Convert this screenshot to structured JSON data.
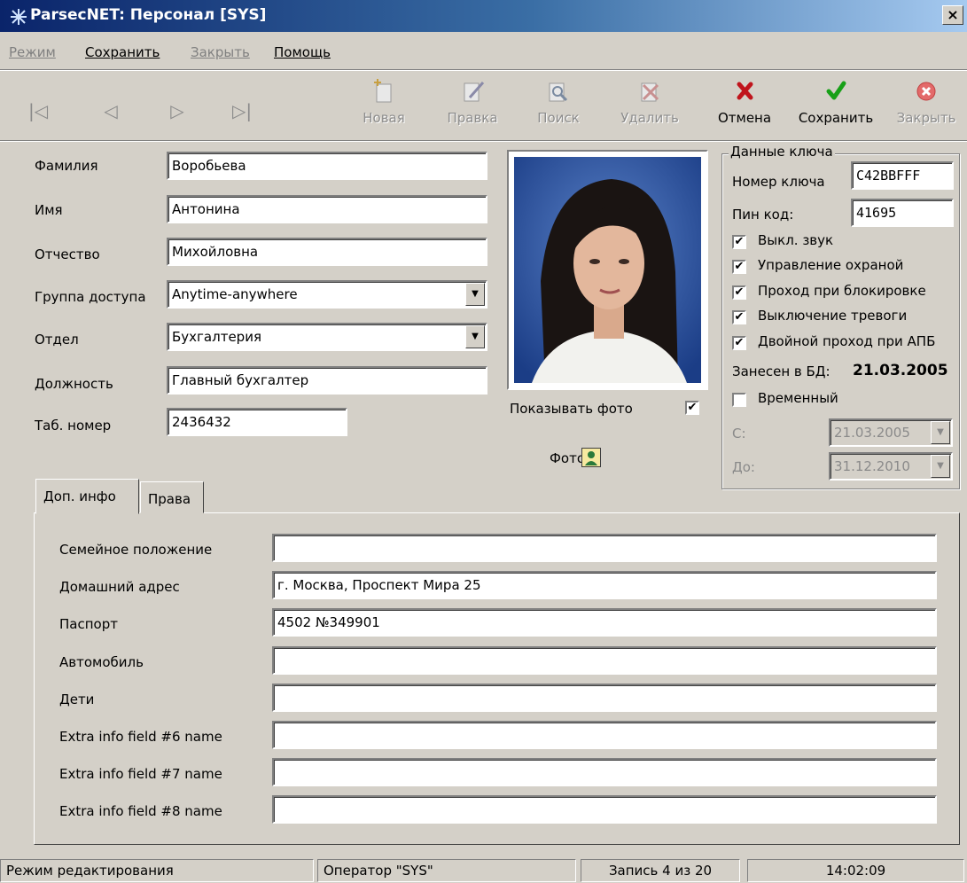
{
  "window": {
    "title": "ParsecNET: Персонал [SYS]",
    "close_glyph": "×"
  },
  "menu": [
    {
      "label": "Режим",
      "enabled": false
    },
    {
      "label": "Сохранить",
      "enabled": true
    },
    {
      "label": "Закрыть",
      "enabled": false
    },
    {
      "label": "Помощь",
      "enabled": true
    }
  ],
  "navigation": {
    "first": "|◁",
    "prev": "◁",
    "next": "▷",
    "last": "▷|"
  },
  "toolbar": {
    "new_label": "Новая",
    "edit_label": "Правка",
    "search_label": "Поиск",
    "delete_label": "Удалить",
    "cancel_label": "Отмена",
    "save_label": "Сохранить",
    "close_label": "Закрыть"
  },
  "person": {
    "lastname_label": "Фамилия",
    "lastname_value": "Воробьева",
    "firstname_label": "Имя",
    "firstname_value": "Антонина",
    "middlename_label": "Отчество",
    "middlename_value": "Михойловна",
    "access_group_label": "Группа доступа",
    "access_group_value": "Anytime-anywhere",
    "department_label": "Отдел",
    "department_value": "Бухгалтерия",
    "position_label": "Должность",
    "position_value": "Главный бухгалтер",
    "tab_number_label": "Таб. номер",
    "tab_number_value": "2436432"
  },
  "photo": {
    "show_label": "Показывать фото",
    "show_checked": true,
    "photo_label": "Фото",
    "check_glyph": "✔"
  },
  "key_data": {
    "group_title": "Данные ключа",
    "key_number_label": "Номер ключа",
    "key_number_value": "C42BBFFF",
    "pin_label": "Пин код:",
    "pin_value": "41695",
    "options": [
      {
        "label": "Выкл. звук",
        "checked": true
      },
      {
        "label": "Управление охраной",
        "checked": true
      },
      {
        "label": "Проход при блокировке",
        "checked": true
      },
      {
        "label": "Выключение тревоги",
        "checked": true
      },
      {
        "label": "Двойной проход при АПБ",
        "checked": true
      }
    ],
    "db_date_label": "Занесен в БД:",
    "db_date_value": "21.03.2005",
    "temporary_label": "Временный",
    "temporary_checked": false,
    "from_label": "С:",
    "from_value": "21.03.2005",
    "to_label": "До:",
    "to_value": "31.12.2010"
  },
  "tabs": [
    {
      "label": "Доп. инфо",
      "active": true
    },
    {
      "label": "Права",
      "active": false
    }
  ],
  "extra_info": [
    {
      "label": "Семейное положение",
      "value": ""
    },
    {
      "label": "Домашний адрес",
      "value": "г. Москва, Проспект Мира 25"
    },
    {
      "label": "Паспорт",
      "value": "4502 №349901"
    },
    {
      "label": "Автомобиль",
      "value": ""
    },
    {
      "label": "Дети",
      "value": ""
    },
    {
      "label": "Extra info field #6 name",
      "value": ""
    },
    {
      "label": "Extra info field #7 name",
      "value": ""
    },
    {
      "label": "Extra info field #8 name",
      "value": ""
    }
  ],
  "status": {
    "mode": "Режим редактирования",
    "operator": "Оператор \"SYS\"",
    "record": "Запись 4 из 20",
    "time": "14:02:09"
  }
}
